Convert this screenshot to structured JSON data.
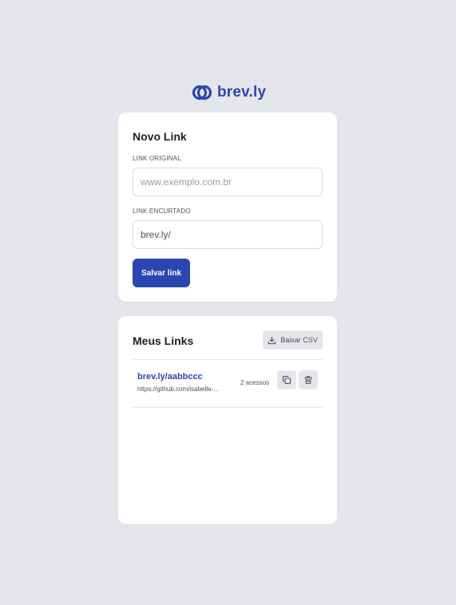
{
  "logo": {
    "text": "brev.ly",
    "icon": "linked-rings-icon"
  },
  "colors": {
    "brand": "#2c46b1",
    "background": "#e4e6ec",
    "card": "#ffffff",
    "text_primary": "#1f2025",
    "text_secondary": "#4d505c",
    "border": "#d6d8de"
  },
  "new_link": {
    "title": "Novo Link",
    "original_label": "LINK ORIGINAL",
    "original_placeholder": "www.exemplo.com.br",
    "original_value": "",
    "short_label": "LINK ENCURTADO",
    "short_value": "brev.ly/",
    "save_label": "Salvar link"
  },
  "my_links": {
    "title": "Meus Links",
    "download_label": "Baixar CSV",
    "download_icon": "download-icon",
    "items": [
      {
        "short_url": "brev.ly/aabbccc",
        "original_url": "https://github.com/isabella-...",
        "access_count": "2 acessos",
        "copy_icon": "copy-icon",
        "delete_icon": "trash-icon"
      }
    ]
  }
}
